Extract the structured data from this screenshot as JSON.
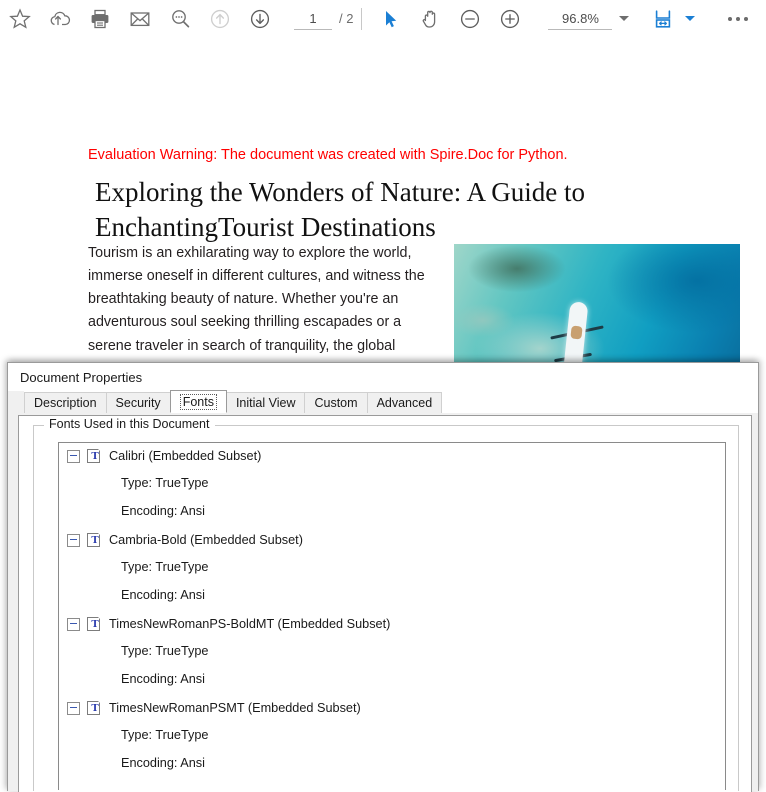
{
  "toolbar": {
    "icons_left": [
      {
        "name": "bookmark-star-icon",
        "label": "Add Bookmark"
      },
      {
        "name": "cloud-upload-icon",
        "label": "Upload to Cloud"
      },
      {
        "name": "print-icon",
        "label": "Print"
      },
      {
        "name": "email-icon",
        "label": "Email"
      },
      {
        "name": "search-icon",
        "label": "Search"
      },
      {
        "name": "previous-page-arrow-icon",
        "label": "Previous Page"
      },
      {
        "name": "next-page-arrow-icon",
        "label": "Next Page"
      }
    ],
    "page": {
      "current": "1",
      "total": "/ 2",
      "placeholder": "1"
    },
    "tools": [
      {
        "name": "select-cursor-icon",
        "label": "Select Tool"
      },
      {
        "name": "hand-pan-icon",
        "label": "Pan Tool"
      },
      {
        "name": "zoom-out-icon",
        "label": "Zoom Out"
      },
      {
        "name": "zoom-in-icon",
        "label": "Zoom In"
      }
    ],
    "zoom": {
      "value": "96.8%",
      "placeholder": "100%"
    },
    "fit_icon_label": "Fit Width",
    "more_label": "More Options"
  },
  "document": {
    "evaluation_warning": "Evaluation Warning: The document was created with Spire.Doc for Python.",
    "title": "Exploring the Wonders of Nature: A Guide to EnchantingTourist Destinations",
    "body": "Tourism is an exhilarating way to explore the world, immerse oneself in different cultures, and witness the breathtaking beauty of nature. Whether you're an adventurous soul seeking thrilling escapades or a serene traveler in search of tranquility, the global tourism landscape has something to offer for",
    "photo_alt": "aerial-photo-kayak-turquoise-water",
    "warning_color": "#ff0000"
  },
  "dialog": {
    "title": "Document Properties",
    "tabs": [
      {
        "label": "Description",
        "selected": false
      },
      {
        "label": "Security",
        "selected": false
      },
      {
        "label": "Fonts",
        "selected": true
      },
      {
        "label": "Initial View",
        "selected": false
      },
      {
        "label": "Custom",
        "selected": false
      },
      {
        "label": "Advanced",
        "selected": false
      }
    ],
    "groupbox_label": "Fonts Used in this Document",
    "fonts": [
      {
        "name": "Calibri (Embedded Subset)",
        "type": "Type: TrueType",
        "encoding": "Encoding: Ansi"
      },
      {
        "name": "Cambria-Bold (Embedded Subset)",
        "type": "Type: TrueType",
        "encoding": "Encoding: Ansi"
      },
      {
        "name": "TimesNewRomanPS-BoldMT (Embedded Subset)",
        "type": "Type: TrueType",
        "encoding": "Encoding: Ansi"
      },
      {
        "name": "TimesNewRomanPSMT (Embedded Subset)",
        "type": "Type: TrueType",
        "encoding": "Encoding: Ansi"
      }
    ],
    "font_icon_glyph": "T"
  }
}
